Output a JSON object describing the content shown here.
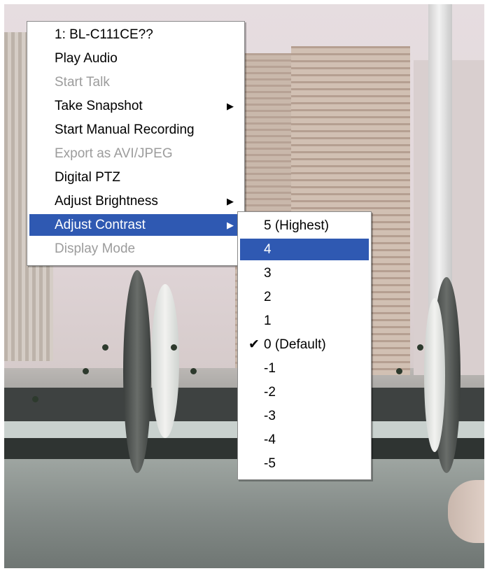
{
  "context_menu": {
    "items": [
      {
        "label": "1: BL-C111CE??",
        "state": "enabled"
      },
      {
        "label": "Play Audio",
        "state": "enabled"
      },
      {
        "label": "Start Talk",
        "state": "disabled"
      },
      {
        "label": "Take Snapshot",
        "state": "enabled",
        "submenu": true
      },
      {
        "label": "Start Manual Recording",
        "state": "enabled"
      },
      {
        "label": "Export as AVI/JPEG",
        "state": "disabled"
      },
      {
        "label": "Digital PTZ",
        "state": "enabled"
      },
      {
        "label": "Adjust Brightness",
        "state": "enabled",
        "submenu": true
      },
      {
        "label": "Adjust Contrast",
        "state": "highlighted",
        "submenu": true
      },
      {
        "label": "Display Mode",
        "state": "disabled"
      }
    ]
  },
  "contrast_submenu": {
    "items": [
      {
        "label": "5 (Highest)"
      },
      {
        "label": "4",
        "state": "highlighted"
      },
      {
        "label": "3"
      },
      {
        "label": "2"
      },
      {
        "label": "1"
      },
      {
        "label": "0 (Default)",
        "checked": true
      },
      {
        "label": "-1"
      },
      {
        "label": "-2"
      },
      {
        "label": "-3"
      },
      {
        "label": "-4"
      },
      {
        "label": "-5"
      }
    ]
  },
  "icons": {
    "submenu_arrow": "triangle-right-icon",
    "checkmark": "checkmark-icon"
  },
  "colors": {
    "highlight": "#2f59b2",
    "disabled_text": "#9c9c9c"
  }
}
